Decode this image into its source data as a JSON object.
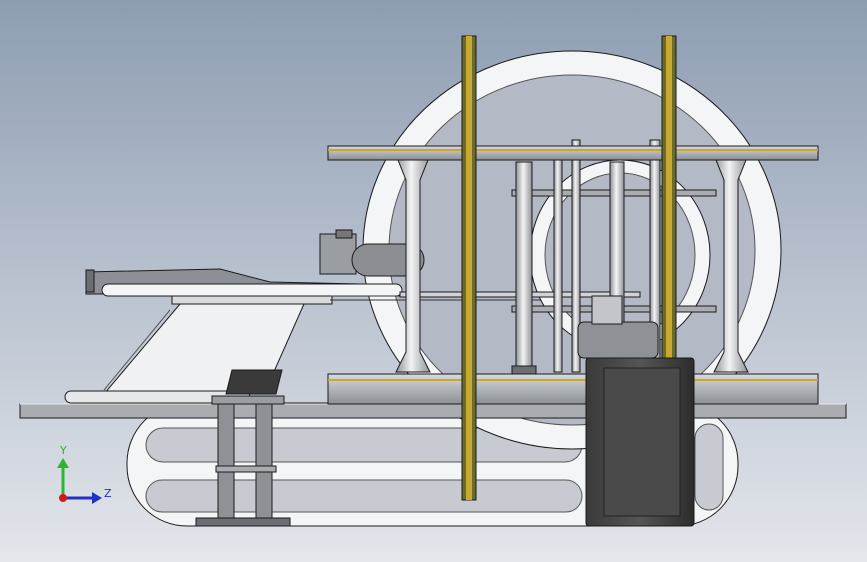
{
  "view": {
    "background_top": "#8e9db2",
    "background_bottom": "#e3e6eb"
  },
  "triad": {
    "y_label": "Y",
    "z_label": "Z",
    "y_color": "#2db52d",
    "z_color": "#2030c8",
    "x_color": "#d01818"
  },
  "palette": {
    "part_white": "#f4f5f6",
    "part_gray": "#a9adb2",
    "part_dark": "#2a2a2a",
    "rail_gold": "#c9a832",
    "outline": "#1a1a1a"
  }
}
